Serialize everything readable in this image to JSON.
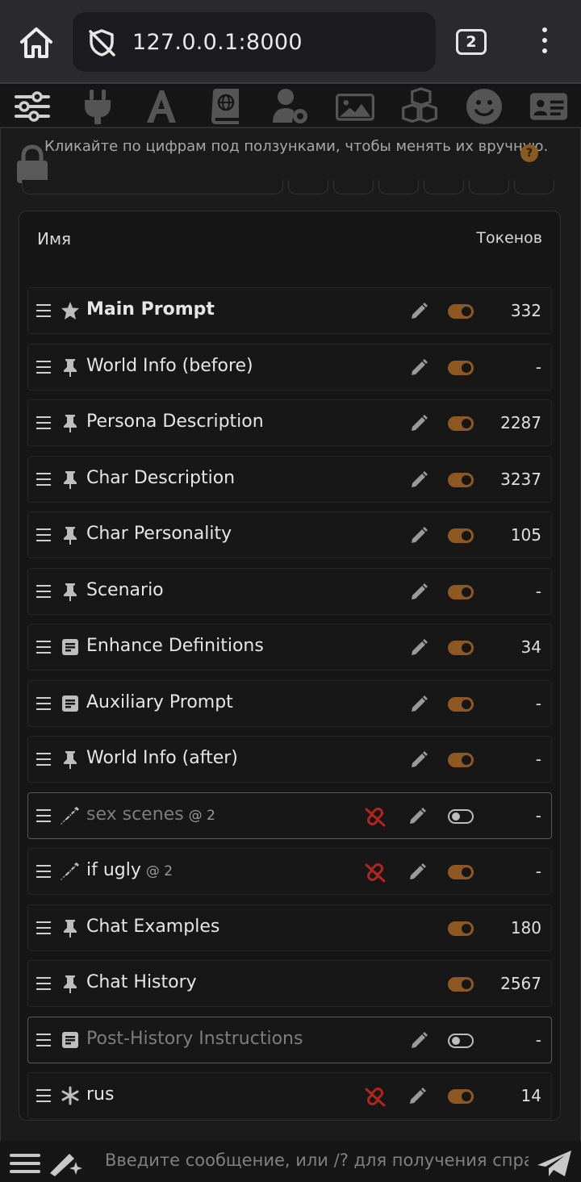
{
  "browser": {
    "url": "127.0.0.1:8000",
    "tab_count": "2"
  },
  "nav_icons": [
    "sliders-icon",
    "plug-icon",
    "font-icon",
    "book-globe-icon",
    "user-gear-icon",
    "image-icon",
    "cubes-icon",
    "smile-icon",
    "id-card-icon"
  ],
  "hint": "Кликайте по цифрам под ползунками, чтобы менять их вручную.",
  "help": "?",
  "prompt_manager": {
    "header_name": "Имя",
    "header_tokens": "Токенов",
    "rows": [
      {
        "name": "Main Prompt",
        "icon": "star-icon",
        "bold": true,
        "enabled": true,
        "tokens": "332",
        "editable": true,
        "unlinked": false,
        "depth": ""
      },
      {
        "name": "World Info (before)",
        "icon": "thumbtack-icon",
        "enabled": true,
        "tokens": "-",
        "editable": true,
        "unlinked": false,
        "depth": ""
      },
      {
        "name": "Persona Description",
        "icon": "thumbtack-icon",
        "enabled": true,
        "tokens": "2287",
        "editable": true,
        "unlinked": false,
        "depth": ""
      },
      {
        "name": "Char Description",
        "icon": "thumbtack-icon",
        "enabled": true,
        "tokens": "3237",
        "editable": true,
        "unlinked": false,
        "depth": ""
      },
      {
        "name": "Char Personality",
        "icon": "thumbtack-icon",
        "enabled": true,
        "tokens": "105",
        "editable": true,
        "unlinked": false,
        "depth": ""
      },
      {
        "name": "Scenario",
        "icon": "thumbtack-icon",
        "enabled": true,
        "tokens": "-",
        "editable": true,
        "unlinked": false,
        "depth": ""
      },
      {
        "name": "Enhance Definitions",
        "icon": "square-poll-icon",
        "enabled": true,
        "tokens": "34",
        "editable": true,
        "unlinked": false,
        "depth": ""
      },
      {
        "name": "Auxiliary Prompt",
        "icon": "square-poll-icon",
        "enabled": true,
        "tokens": "-",
        "editable": true,
        "unlinked": false,
        "depth": ""
      },
      {
        "name": "World Info (after)",
        "icon": "thumbtack-icon",
        "enabled": true,
        "tokens": "-",
        "editable": true,
        "unlinked": false,
        "depth": ""
      },
      {
        "name": "sex scenes",
        "icon": "syringe-icon",
        "enabled": false,
        "tokens": "-",
        "editable": true,
        "unlinked": true,
        "depth": "@ 2"
      },
      {
        "name": "if ugly",
        "icon": "syringe-icon",
        "enabled": true,
        "tokens": "-",
        "editable": true,
        "unlinked": true,
        "depth": "@ 2"
      },
      {
        "name": "Chat Examples",
        "icon": "thumbtack-icon",
        "enabled": true,
        "tokens": "180",
        "editable": false,
        "unlinked": false,
        "depth": ""
      },
      {
        "name": "Chat History",
        "icon": "thumbtack-icon",
        "enabled": true,
        "tokens": "2567",
        "editable": false,
        "unlinked": false,
        "depth": ""
      },
      {
        "name": "Post-History Instructions",
        "icon": "square-poll-icon",
        "enabled": false,
        "tokens": "-",
        "editable": true,
        "unlinked": false,
        "depth": ""
      },
      {
        "name": "rus",
        "icon": "asterisk-icon",
        "enabled": true,
        "tokens": "14",
        "editable": true,
        "unlinked": true,
        "depth": ""
      }
    ]
  },
  "composer": {
    "placeholder": "Введите сообщение, или /? для получения спра"
  },
  "colors": {
    "accent": "#8f5822",
    "unlink": "#b3261e",
    "background": "#121212"
  }
}
